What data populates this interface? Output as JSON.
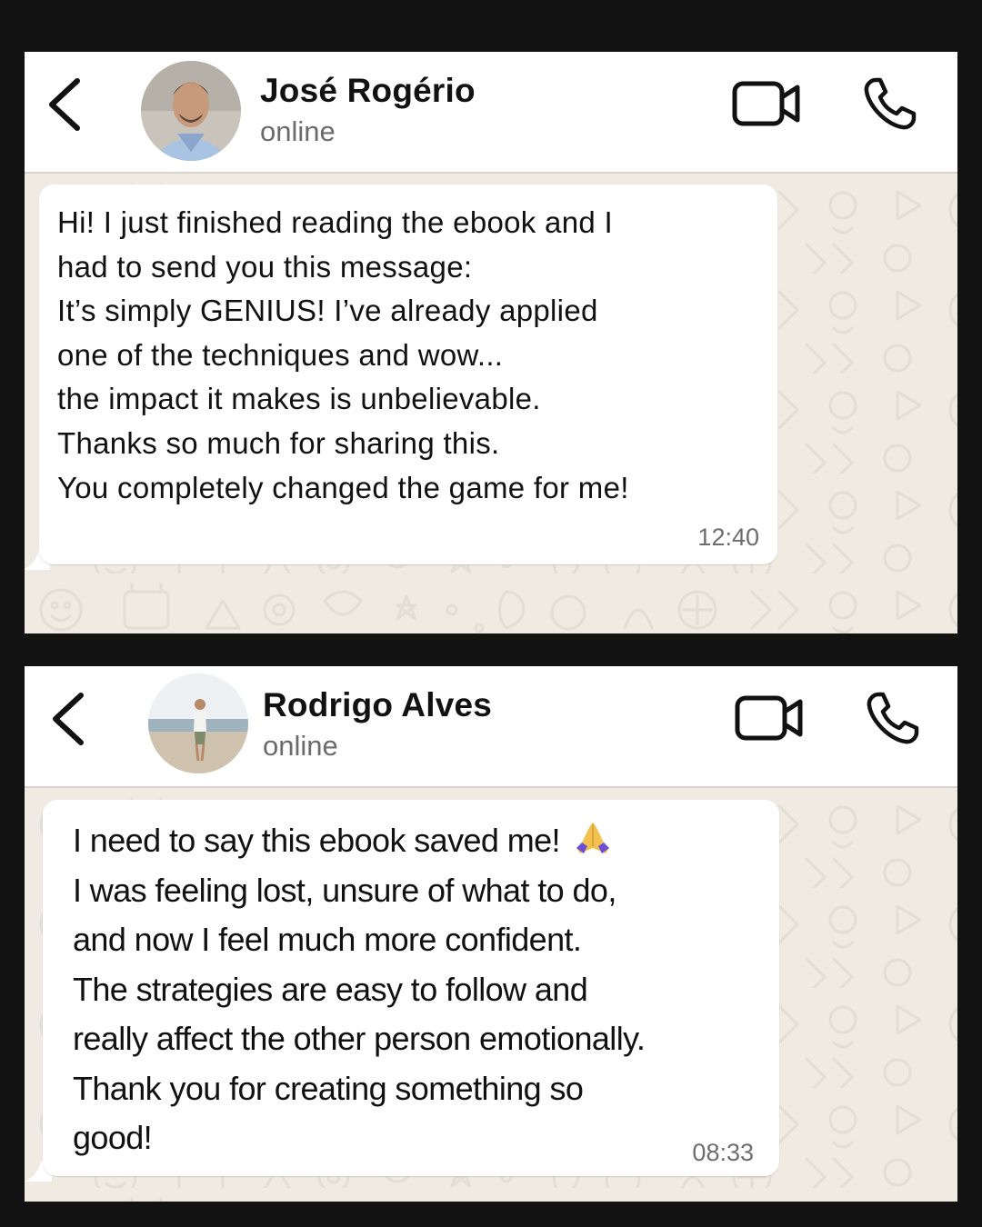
{
  "chats": [
    {
      "contact_name": "José Rogério",
      "status": "online",
      "message_lines": [
        "Hi! I just finished reading the ebook and I",
        "had to send you this message:",
        "It’s simply GENIUS! I’ve already applied",
        "one of the techniques and wow...",
        "the impact it makes is unbelievable.",
        "Thanks so much for sharing this.",
        "You completely changed the game for me!"
      ],
      "time": "12:40"
    },
    {
      "contact_name": "Rodrigo Alves",
      "status": "online",
      "message_lines": [
        "I need to say this ebook saved me!",
        "I was feeling lost, unsure of what to do,",
        "and now I feel much more confident.",
        "The strategies are easy to follow and",
        "really affect the other person emotionally.",
        "Thank you for creating something so",
        "good!"
      ],
      "time": "08:33",
      "emoji": "folded-hands-emoji"
    }
  ],
  "icons": {
    "back": "chevron-left-icon",
    "video": "video-camera-icon",
    "phone": "phone-icon"
  },
  "colors": {
    "page_background": "#121212",
    "chat_background": "#efeae2",
    "bubble": "#ffffff",
    "header": "#ffffff",
    "status_text": "#6b6b6b"
  }
}
